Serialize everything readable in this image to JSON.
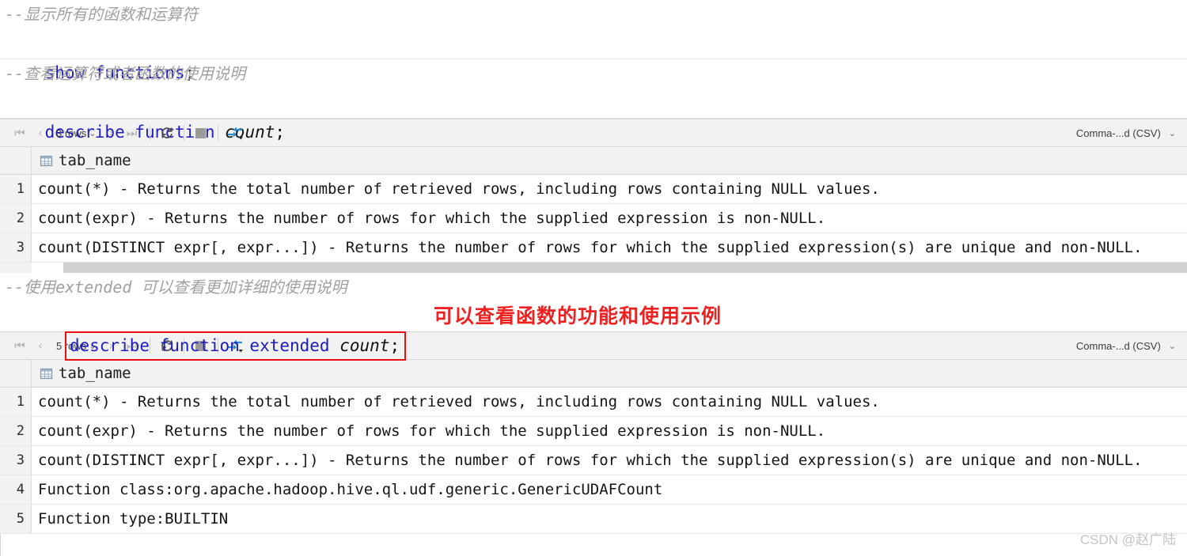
{
  "editor": {
    "lines": [
      {
        "type": "comment",
        "text": "--显示所有的函数和运算符"
      },
      {
        "type": "sql",
        "keyword": "show functions",
        "ident": "",
        "punct": ";"
      },
      {
        "type": "comment",
        "text": "--查看运算符或者函数的使用说明"
      },
      {
        "type": "sql",
        "keyword": "describe function ",
        "ident": "count",
        "punct": ";"
      }
    ],
    "second_block": {
      "comment": "--使用extended 可以查看更加详细的使用说明",
      "keyword": "describe function extended ",
      "ident": "count",
      "punct": ";"
    }
  },
  "annotation": {
    "text": "可以查看函数的功能和使用示例",
    "color": "#ef2020"
  },
  "grid1": {
    "toolbar": {
      "first_icon": "⏮",
      "prev_icon": "‹",
      "rows_label": "3 rows",
      "caret": "⌄",
      "next_icon": "›",
      "last_icon": "⏭",
      "refresh_icon": "refresh-icon",
      "stop_icon": "stop-icon",
      "transpose_icon": "transpose-icon",
      "export_label": "Comma-...d (CSV)",
      "export_caret": "⌄"
    },
    "column": "tab_name",
    "rows": [
      {
        "num": "1",
        "value": "count(*) - Returns the total number of retrieved rows, including rows containing NULL values."
      },
      {
        "num": "2",
        "value": "count(expr) - Returns the number of rows for which the supplied expression is non-NULL."
      },
      {
        "num": "3",
        "value": "count(DISTINCT expr[, expr...]) - Returns the number of rows for which the supplied expression(s) are unique and non-NULL."
      }
    ]
  },
  "grid2": {
    "toolbar": {
      "first_icon": "⏮",
      "prev_icon": "‹",
      "rows_label": "5 rows",
      "caret": "⌄",
      "next_icon": "›",
      "last_icon": "⏭",
      "refresh_icon": "refresh-icon",
      "stop_icon": "stop-icon",
      "transpose_icon": "transpose-icon",
      "export_label": "Comma-...d (CSV)",
      "export_caret": "⌄"
    },
    "column": "tab_name",
    "rows": [
      {
        "num": "1",
        "value": "count(*) - Returns the total number of retrieved rows, including rows containing NULL values."
      },
      {
        "num": "2",
        "value": "count(expr) - Returns the number of rows for which the supplied expression is non-NULL."
      },
      {
        "num": "3",
        "value": "count(DISTINCT expr[, expr...]) - Returns the number of rows for which the supplied expression(s) are unique and non-NULL."
      },
      {
        "num": "4",
        "value": "Function class:org.apache.hadoop.hive.ql.udf.generic.GenericUDAFCount"
      },
      {
        "num": "5",
        "value": "Function type:BUILTIN"
      }
    ]
  },
  "watermark": "CSDN @赵广陆"
}
